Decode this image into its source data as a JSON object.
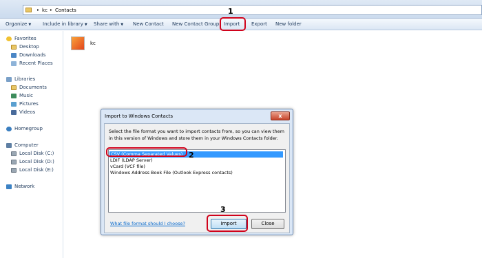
{
  "address": {
    "crumbs": [
      "kc",
      "Contacts"
    ]
  },
  "toolbar": {
    "organize": "Organize",
    "include_in_library": "Include in library",
    "share_with": "Share with",
    "new_contact": "New Contact",
    "new_contact_group": "New Contact Group",
    "import": "Import",
    "export": "Export",
    "new_folder": "New folder"
  },
  "nav": {
    "favorites": "Favorites",
    "desktop": "Desktop",
    "downloads": "Downloads",
    "recent_places": "Recent Places",
    "libraries": "Libraries",
    "documents": "Documents",
    "music": "Music",
    "pictures": "Pictures",
    "videos": "Videos",
    "homegroup": "Homegroup",
    "computer": "Computer",
    "disk_c": "Local Disk (C:)",
    "disk_d": "Local Disk (D:)",
    "disk_e": "Local Disk (E:)",
    "network": "Network"
  },
  "content": {
    "contact_name": "kc"
  },
  "dialog": {
    "title": "Import to Windows Contacts",
    "close_glyph": "x",
    "instructions": "Select the file format you want to import contacts from, so you can view them in this version of Windows and store them in your Windows Contacts folder.",
    "formats": [
      "CSV (Comma Separated Values)",
      "LDIF (LDAP Server)",
      "vCard (VCF file)",
      "Windows Address Book File (Outlook Express contacts)"
    ],
    "help_link": "What file format should I choose?",
    "import_button": "Import",
    "close_button": "Close"
  },
  "annotations": {
    "step1": "1",
    "step2": "2",
    "step3": "3",
    "color": "#d0021b"
  }
}
